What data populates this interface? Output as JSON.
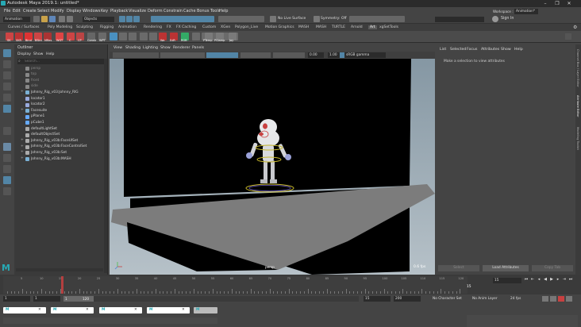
{
  "window": {
    "title": "Autodesk Maya 2019.1: untitled*",
    "controls": [
      "–",
      "❐",
      "✕"
    ]
  },
  "menus": [
    "File",
    "Edit",
    "Create",
    "Select",
    "Modify",
    "Display",
    "Windows",
    "Key",
    "Playback",
    "Visualize",
    "Deform",
    "Constrain",
    "Cache",
    "Bonus Tools",
    "Help"
  ],
  "statusline": {
    "mode": "Animation",
    "objects_label": "Objects",
    "live_surface": "No Live Surface",
    "symmetry": "Symmetry: Off",
    "sign_in": "Sign In",
    "workspace_label": "Workspace :",
    "workspace_value": "Animation*"
  },
  "shelf_tabs": [
    "Curves / Surfaces",
    "Poly Modeling",
    "Sculpting",
    "Rigging",
    "Animation",
    "Rendering",
    "FX",
    "FX Caching",
    "Custom",
    "XGen",
    "Polygon_Live",
    "Motion Graphics",
    "MASH",
    "MASH",
    "TURTLE",
    "Arnold",
    "Art",
    "xgSetTools"
  ],
  "active_shelf_tab": "Art",
  "shelf_icon_labels": [
    "SK",
    "SKR",
    "Bind",
    "BSkn",
    "MRes",
    "WGT",
    "C",
    "CP",
    "Constr",
    "WPT",
    "",
    "",
    "",
    "",
    "",
    "Wa",
    "EdR",
    "RGB",
    "",
    "",
    "",
    "",
    "",
    "PTemp",
    "PClamp",
    "Jay"
  ],
  "outliner": {
    "title": "Outliner",
    "menus": [
      "Display",
      "Show",
      "Help"
    ],
    "search_placeholder": "Search...",
    "items": [
      {
        "label": "persp",
        "dim": true
      },
      {
        "label": "top",
        "dim": true
      },
      {
        "label": "front",
        "dim": true
      },
      {
        "label": "side",
        "dim": true
      },
      {
        "label": "Johnny_Rig_v03:Johnny_RIG",
        "dim": false
      },
      {
        "label": "locator1",
        "dim": false
      },
      {
        "label": "locator2",
        "dim": false
      },
      {
        "label": "Facesuite",
        "dim": false
      },
      {
        "label": "pPlane1",
        "dim": false
      },
      {
        "label": "pCube1",
        "dim": false
      },
      {
        "label": "defaultLightSet",
        "dim": false
      },
      {
        "label": "defaultObjectSet",
        "dim": false
      },
      {
        "label": "Johnny_Rig_v03b:FaceUISet",
        "dim": false
      },
      {
        "label": "Johnny_Rig_v03b:FaceControlSet",
        "dim": false
      },
      {
        "label": "Johnny_Rig_v03b:Set",
        "dim": false
      },
      {
        "label": "Johnny_Rig_v03b:MASH",
        "dim": false
      }
    ]
  },
  "viewport": {
    "menus": [
      "View",
      "Shading",
      "Lighting",
      "Show",
      "Renderer",
      "Panels"
    ],
    "field_a": "0.00",
    "field_b": "1.00",
    "colorspace": "sRGB gamma",
    "camera_label": "persp",
    "fps": "0.6 fps"
  },
  "attribute_editor": {
    "menus": [
      "List",
      "Selected",
      "Focus",
      "Attributes",
      "Show",
      "Help"
    ],
    "message": "Make a selection to view attributes",
    "buttons": [
      "Select",
      "Load Attributes",
      "Copy Tab"
    ],
    "side_tabs": [
      "Channel Box / Layer Editor",
      "Attribute Editor",
      "Modeling Toolkit"
    ]
  },
  "timeline": {
    "ticks": [
      "5",
      "10",
      "15",
      "20",
      "25",
      "30",
      "35",
      "40",
      "45",
      "50",
      "55",
      "60",
      "65",
      "70",
      "75",
      "80",
      "85",
      "90",
      "95",
      "100",
      "105",
      "110",
      "115",
      "120"
    ],
    "current_frame": "15",
    "current_frame_box": "15"
  },
  "range": {
    "start": "1",
    "start_inner": "1",
    "range_inner": "1",
    "range_end": "120",
    "end_inner": "15",
    "end": "200",
    "character_set": "No Character Set",
    "anim_layer": "No Anim Layer",
    "fps": "24 fps"
  },
  "taskbar_items": [
    "M",
    "M",
    "M",
    "M",
    "M"
  ],
  "colors": {
    "accent_blue": "#5285a6",
    "selected_red": "#c84040",
    "maya_logo": "#27a9b4"
  }
}
